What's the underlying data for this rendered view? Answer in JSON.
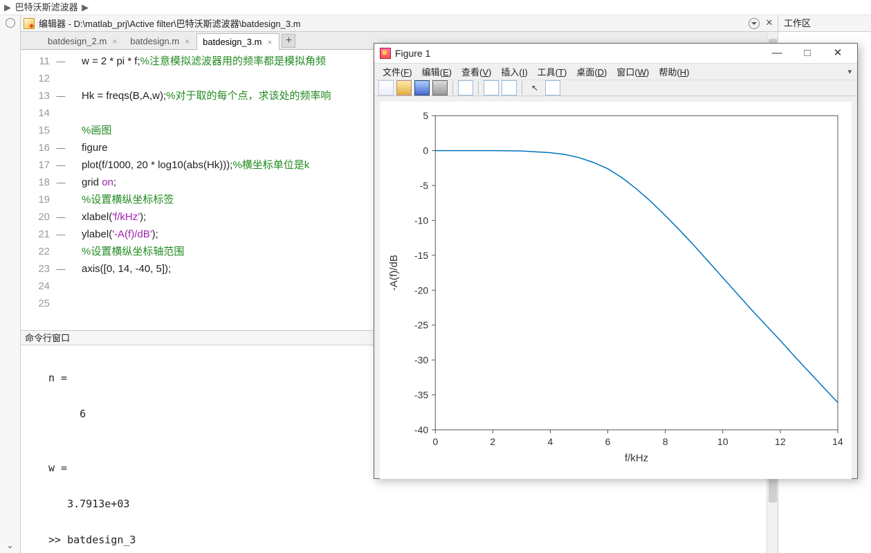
{
  "breadcrumb": {
    "item": "巴特沃斯滤波器"
  },
  "editor": {
    "header_prefix": "编辑器 - ",
    "path": "D:\\matlab_prj\\Active filter\\巴特沃斯滤波器\\batdesign_3.m",
    "tabs": [
      {
        "label": "batdesign_2.m",
        "active": false
      },
      {
        "label": "batdesign.m",
        "active": false
      },
      {
        "label": "batdesign_3.m",
        "active": true
      }
    ],
    "first_line": 11,
    "lines": [
      {
        "mark": "—",
        "segs": [
          {
            "t": "w = 2 * pi * f;"
          },
          {
            "t": "%注意模拟滤波器用的频率都是模拟角频",
            "c": "cm"
          }
        ]
      },
      {
        "mark": "",
        "segs": [
          {
            "t": ""
          }
        ]
      },
      {
        "mark": "—",
        "segs": [
          {
            "t": "Hk = freqs(B,A,w);"
          },
          {
            "t": "%对于取的每个点，求该处的频率响",
            "c": "cm"
          }
        ]
      },
      {
        "mark": "",
        "segs": [
          {
            "t": ""
          }
        ]
      },
      {
        "mark": "",
        "segs": [
          {
            "t": "%画图",
            "c": "cm"
          }
        ]
      },
      {
        "mark": "—",
        "segs": [
          {
            "t": "figure"
          }
        ]
      },
      {
        "mark": "—",
        "segs": [
          {
            "t": "plot(f/1000, 20 * log10(abs(Hk)));"
          },
          {
            "t": "%横坐标单位是k",
            "c": "cm"
          }
        ]
      },
      {
        "mark": "—",
        "segs": [
          {
            "t": "grid "
          },
          {
            "t": "on",
            "c": "str"
          },
          {
            "t": ";"
          }
        ]
      },
      {
        "mark": "",
        "segs": [
          {
            "t": "%设置横纵坐标标签",
            "c": "cm"
          }
        ]
      },
      {
        "mark": "—",
        "segs": [
          {
            "t": "xlabel("
          },
          {
            "t": "'f/kHz'",
            "c": "str"
          },
          {
            "t": ");"
          }
        ]
      },
      {
        "mark": "—",
        "segs": [
          {
            "t": "ylabel("
          },
          {
            "t": "'-A(f)/dB'",
            "c": "str"
          },
          {
            "t": ");"
          }
        ]
      },
      {
        "mark": "",
        "segs": [
          {
            "t": "%设置横纵坐标轴范围",
            "c": "cm"
          }
        ]
      },
      {
        "mark": "—",
        "segs": [
          {
            "t": "axis([0, 14, -40, 5]);"
          }
        ]
      },
      {
        "mark": "",
        "segs": [
          {
            "t": ""
          }
        ]
      },
      {
        "mark": "",
        "segs": [
          {
            "t": ""
          }
        ]
      }
    ]
  },
  "command_window": {
    "title": "命令行窗口",
    "content": "\nn =\n\n     6\n\n\nw =\n\n   3.7913e+03\n\n>> batdesign_3"
  },
  "workspace": {
    "title": "工作区"
  },
  "figure": {
    "title": "Figure 1",
    "menu": [
      "文件(F)",
      "编辑(E)",
      "查看(V)",
      "插入(I)",
      "工具(T)",
      "桌面(D)",
      "窗口(W)",
      "帮助(H)"
    ]
  },
  "chart_data": {
    "type": "line",
    "title": "",
    "xlabel": "f/kHz",
    "ylabel": "-A(f)/dB",
    "xlim": [
      0,
      14
    ],
    "ylim": [
      -40,
      5
    ],
    "xticks": [
      0,
      2,
      4,
      6,
      8,
      10,
      12,
      14
    ],
    "yticks": [
      -40,
      -35,
      -30,
      -25,
      -20,
      -15,
      -10,
      -5,
      0,
      5
    ],
    "grid": false,
    "x": [
      0,
      1,
      2,
      3,
      4,
      4.5,
      5,
      5.5,
      6,
      6.5,
      7,
      7.5,
      8,
      8.5,
      9,
      9.5,
      10,
      10.5,
      11,
      11.5,
      12,
      12.5,
      13,
      13.5,
      14
    ],
    "values": [
      0,
      0,
      0,
      -0.05,
      -0.3,
      -0.55,
      -1.0,
      -1.7,
      -2.6,
      -3.9,
      -5.5,
      -7.3,
      -9.3,
      -11.4,
      -13.6,
      -15.9,
      -18.2,
      -20.5,
      -22.8,
      -25.0,
      -27.2,
      -29.5,
      -31.7,
      -33.9,
      -36.1
    ]
  }
}
